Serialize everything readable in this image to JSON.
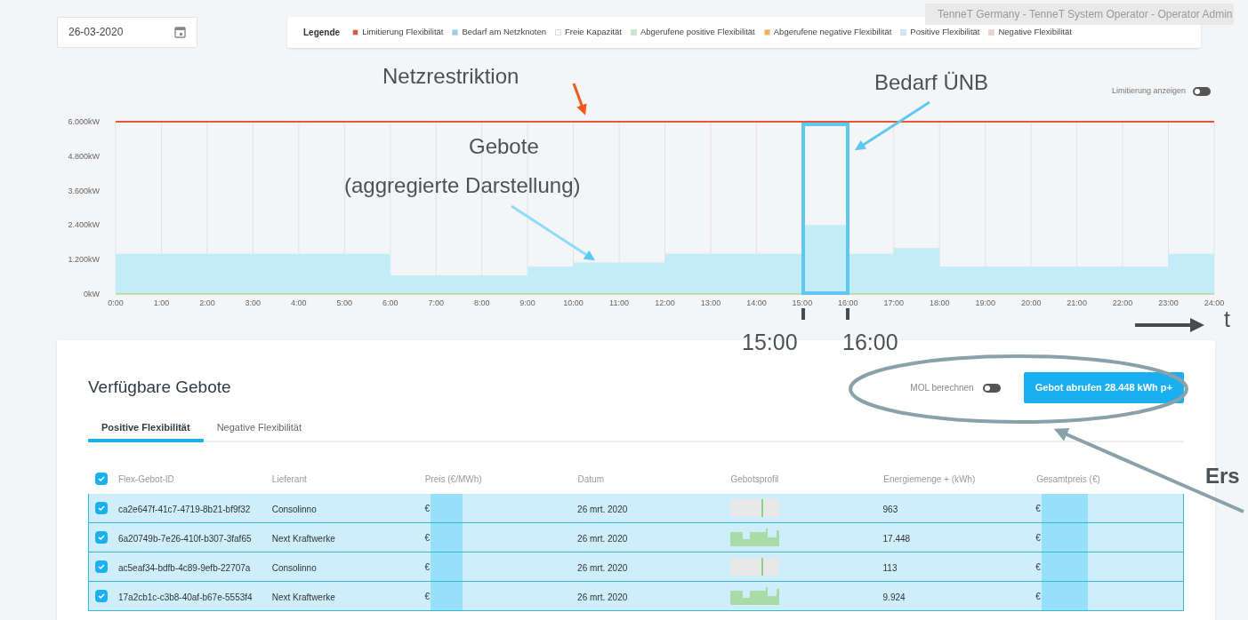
{
  "date_field": {
    "value": "26-03-2020"
  },
  "user_label": "TenneT Germany - TenneT System Operator - Operator Admin",
  "legend": {
    "title": "Legende",
    "items": [
      {
        "label": "Limitierung Flexibilität",
        "color": "#e8553a"
      },
      {
        "label": "Bedarf am Netzknoten",
        "color": "#8fd0ec"
      },
      {
        "label": "Freie Kapazität",
        "color": "#ffffff"
      },
      {
        "label": "Abgerufene positive Flexibilität",
        "color": "#c8e6c9"
      },
      {
        "label": "Abgerufene negative Flexibilität",
        "color": "#f5b041"
      },
      {
        "label": "Positive Flexibilität",
        "color": "#c4ebf8"
      },
      {
        "label": "Negative Flexibilität",
        "color": "#f5cdc9"
      }
    ]
  },
  "limit_toggle": {
    "label": "Limitierung anzeigen",
    "on": false
  },
  "chart": {
    "chart_data": {
      "type": "bar",
      "categories": [
        "0:00",
        "1:00",
        "2:00",
        "3:00",
        "4:00",
        "5:00",
        "6:00",
        "7:00",
        "8:00",
        "9:00",
        "10:00",
        "11:00",
        "12:00",
        "13:00",
        "14:00",
        "15:00",
        "16:00",
        "17:00",
        "18:00",
        "19:00",
        "20:00",
        "21:00",
        "22:00",
        "23:00"
      ],
      "series": [
        {
          "color": "#c4ebf8",
          "values": [
            1400,
            1400,
            1400,
            1400,
            1400,
            1400,
            650,
            650,
            650,
            950,
            1100,
            1100,
            1400,
            1400,
            1400,
            2400,
            1400,
            1600,
            950,
            950,
            950,
            950,
            950,
            1400
          ]
        }
      ],
      "ylim": [
        0,
        6000
      ],
      "yticks": [
        {
          "value": 0,
          "label": "0kW"
        },
        {
          "value": 1200,
          "label": "1.200kW"
        },
        {
          "value": 2400,
          "label": "2.400kW"
        },
        {
          "value": 3600,
          "label": "3.600kW"
        },
        {
          "value": 4800,
          "label": "4.800kW"
        },
        {
          "value": 6000,
          "label": "6.000kW"
        }
      ],
      "grid": true
    },
    "axis_end_label": "24:00"
  },
  "offers": {
    "title": "Verfügbare Gebote",
    "mol_toggle": {
      "label": "MOL berechnen",
      "on": false
    },
    "call_button": "Gebot abrufen 28.448 kWh p+",
    "tabs": [
      {
        "label": "Positive Flexibilität",
        "selected": true
      },
      {
        "label": "Negative Flexibilität",
        "selected": false
      }
    ],
    "table": {
      "all_checked": true,
      "columns": [
        "Flex-Gebot-ID",
        "Lieferant",
        "Preis (€/MWh)",
        "Datum",
        "Gebotsprofil",
        "Energiemenge + (kWh)",
        "Gesamtpreis (€)"
      ],
      "rows": [
        {
          "checked": true,
          "selected": true,
          "id": "ca2e647f-41c7-4719-8b21-bf9f32",
          "supplier": "Consolinno",
          "price": "€",
          "date": "26 mrt. 2020",
          "kind": "narrow",
          "energy": "963",
          "total": "€"
        },
        {
          "checked": true,
          "selected": true,
          "id": "6a20749b-7e26-410f-b307-3faf65",
          "supplier": "Next Kraftwerke",
          "price": "€",
          "date": "26 mrt. 2020",
          "kind": "broad",
          "energy": "17.448",
          "total": "€"
        },
        {
          "checked": true,
          "selected": true,
          "id": "ac5eaf34-bdfb-4c89-9efb-22707a",
          "supplier": "Consolinno",
          "price": "€",
          "date": "26 mrt. 2020",
          "kind": "narrow",
          "energy": "113",
          "total": "€"
        },
        {
          "checked": true,
          "selected": true,
          "id": "17a2cb1c-c3b8-40af-b67e-5553f4",
          "supplier": "Next Kraftwerke",
          "price": "€",
          "date": "26 mrt. 2020",
          "kind": "broad",
          "energy": "9.924",
          "total": "€"
        }
      ]
    }
  },
  "annotations": [
    "Netzrestriktion",
    "Bedarf ÜNB",
    "Gebote",
    "(aggregierte Darstellung)",
    "15:00",
    "16:00",
    "t",
    "Ers"
  ]
}
